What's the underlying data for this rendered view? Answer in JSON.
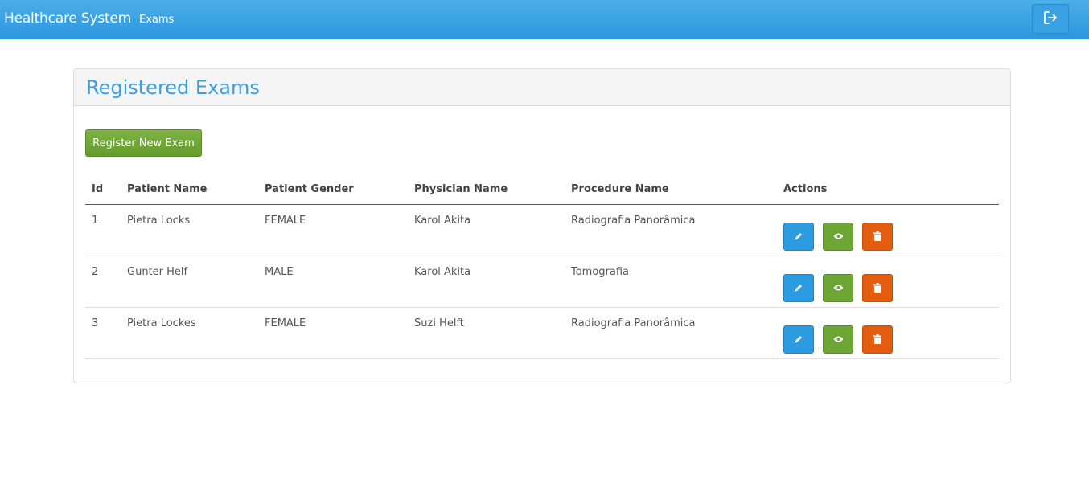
{
  "navbar": {
    "brand": "Healthcare System",
    "links": [
      {
        "label": "Exams"
      }
    ],
    "logout_icon": "logout-icon"
  },
  "panel": {
    "title": "Registered Exams",
    "register_button": "Register New Exam"
  },
  "table": {
    "headers": [
      "Id",
      "Patient Name",
      "Patient Gender",
      "Physician Name",
      "Procedure Name",
      "Actions"
    ],
    "rows": [
      {
        "id": "1",
        "patient": "Pietra Locks",
        "gender": "FEMALE",
        "physician": "Karol Akita",
        "procedure": "Radiografia Panorâmica"
      },
      {
        "id": "2",
        "patient": "Gunter Helf",
        "gender": "MALE",
        "physician": "Karol Akita",
        "procedure": "Tomografia"
      },
      {
        "id": "3",
        "patient": "Pietra Lockes",
        "gender": "FEMALE",
        "physician": "Suzi Helft",
        "procedure": "Radiografia Panorâmica"
      }
    ],
    "action_icons": [
      "pencil-icon",
      "eye-icon",
      "trash-icon"
    ]
  },
  "colors": {
    "primary": "#2d9be2",
    "success": "#6ea636",
    "danger": "#e25d0e",
    "title": "#3a9ee4"
  }
}
